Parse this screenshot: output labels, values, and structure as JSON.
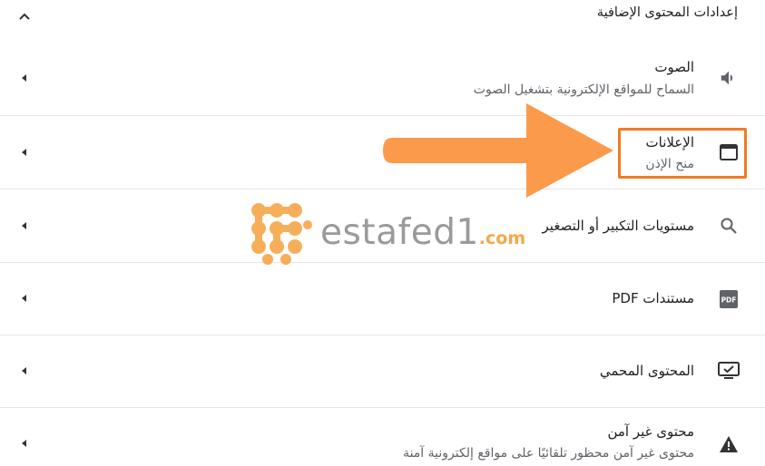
{
  "header": {
    "title": "إعدادات المحتوى الإضافية",
    "collapse_icon": "chevron-up-icon"
  },
  "rows": [
    {
      "label": "الصوت",
      "sublabel": "السماح للمواقع الإلكترونية بتشغيل الصوت",
      "icon": "speaker-icon"
    },
    {
      "label": "الإعلانات",
      "sublabel": "منح الإذن",
      "icon": "ads-window-icon"
    },
    {
      "label": "مستويات التكبير أو التصغير",
      "icon": "search-icon"
    },
    {
      "label": "مستندات PDF",
      "icon": "pdf-icon"
    },
    {
      "label": "المحتوى المحمي",
      "icon": "protected-content-icon"
    },
    {
      "label": "محتوى غير آمن",
      "sublabel": "محتوى غير آمن محظور تلقائيًا على مواقع إلكترونية آمنة",
      "icon": "warning-icon"
    }
  ],
  "pdf_icon_text": "PDF",
  "watermark": {
    "text": "estafed1",
    "suffix": ".com"
  },
  "colors": {
    "highlight": "#f07a22",
    "arrow": "#fb9a4b",
    "watermark_logo": "#f7a64a"
  }
}
